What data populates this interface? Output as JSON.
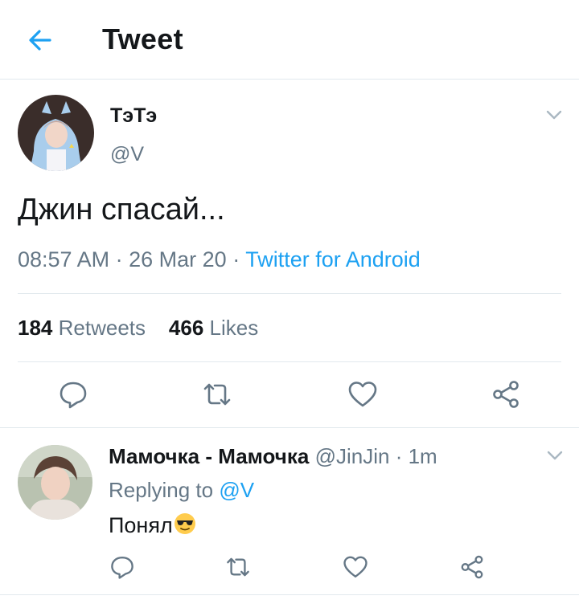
{
  "header": {
    "title": "Tweet",
    "back_icon": "arrow-left-icon"
  },
  "tweet": {
    "author_name": "ТэТэ",
    "author_handle": "@V",
    "text": "Джин спасай...",
    "time": "08:57 AM",
    "date": "26 Mar 20",
    "source": "Twitter for Android",
    "retweets_count": "184",
    "retweets_label": "Retweets",
    "likes_count": "466",
    "likes_label": "Likes",
    "actions": [
      "reply-icon",
      "retweet-icon",
      "like-icon",
      "share-icon"
    ]
  },
  "reply": {
    "author_name": "Мамочка - Мамочка",
    "author_handle": "@JinJin",
    "time": "1m",
    "replying_label": "Replying to",
    "replying_to": "@V",
    "text": "Понял",
    "emoji": "sunglasses-emoji"
  },
  "colors": {
    "accent": "#1da1f2",
    "muted": "#657786",
    "text": "#14171a",
    "divider": "#e1e8ed"
  }
}
